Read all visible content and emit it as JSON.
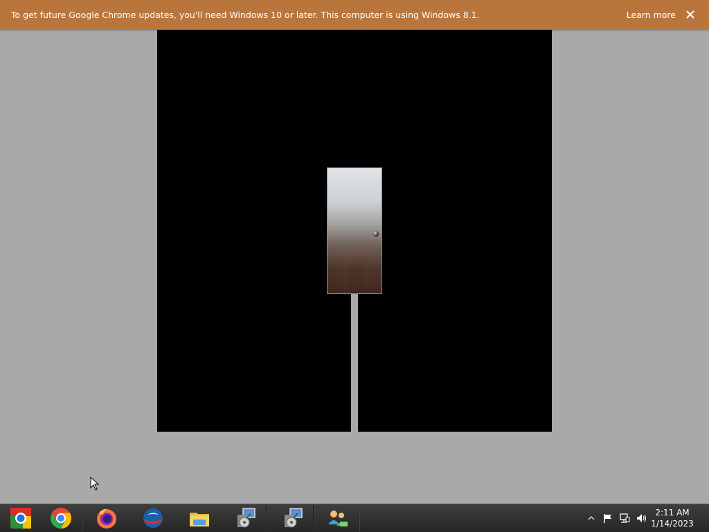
{
  "infobar": {
    "message": "To get future Google Chrome updates, you'll need Windows 10 or later. This computer is using Windows 8.1.",
    "learn_more": "Learn more",
    "close_icon": "close-icon",
    "background_color": "#b8763d"
  },
  "stage": {
    "background_color": "#000000",
    "objects": [
      "door",
      "door-knob",
      "path"
    ]
  },
  "taskbar": {
    "pinned": [
      {
        "name": "chromium-icon"
      },
      {
        "name": "chrome-icon"
      },
      {
        "name": "firefox-icon"
      },
      {
        "name": "opera-icon"
      },
      {
        "name": "file-explorer-icon"
      },
      {
        "name": "installer-icon"
      },
      {
        "name": "installer-icon"
      },
      {
        "name": "network-users-icon"
      }
    ],
    "tray_icons": [
      "chevron-up-icon",
      "flag-icon",
      "network-icon",
      "volume-icon"
    ],
    "clock": {
      "time": "2:11 AM",
      "date": "1/14/2023"
    }
  }
}
